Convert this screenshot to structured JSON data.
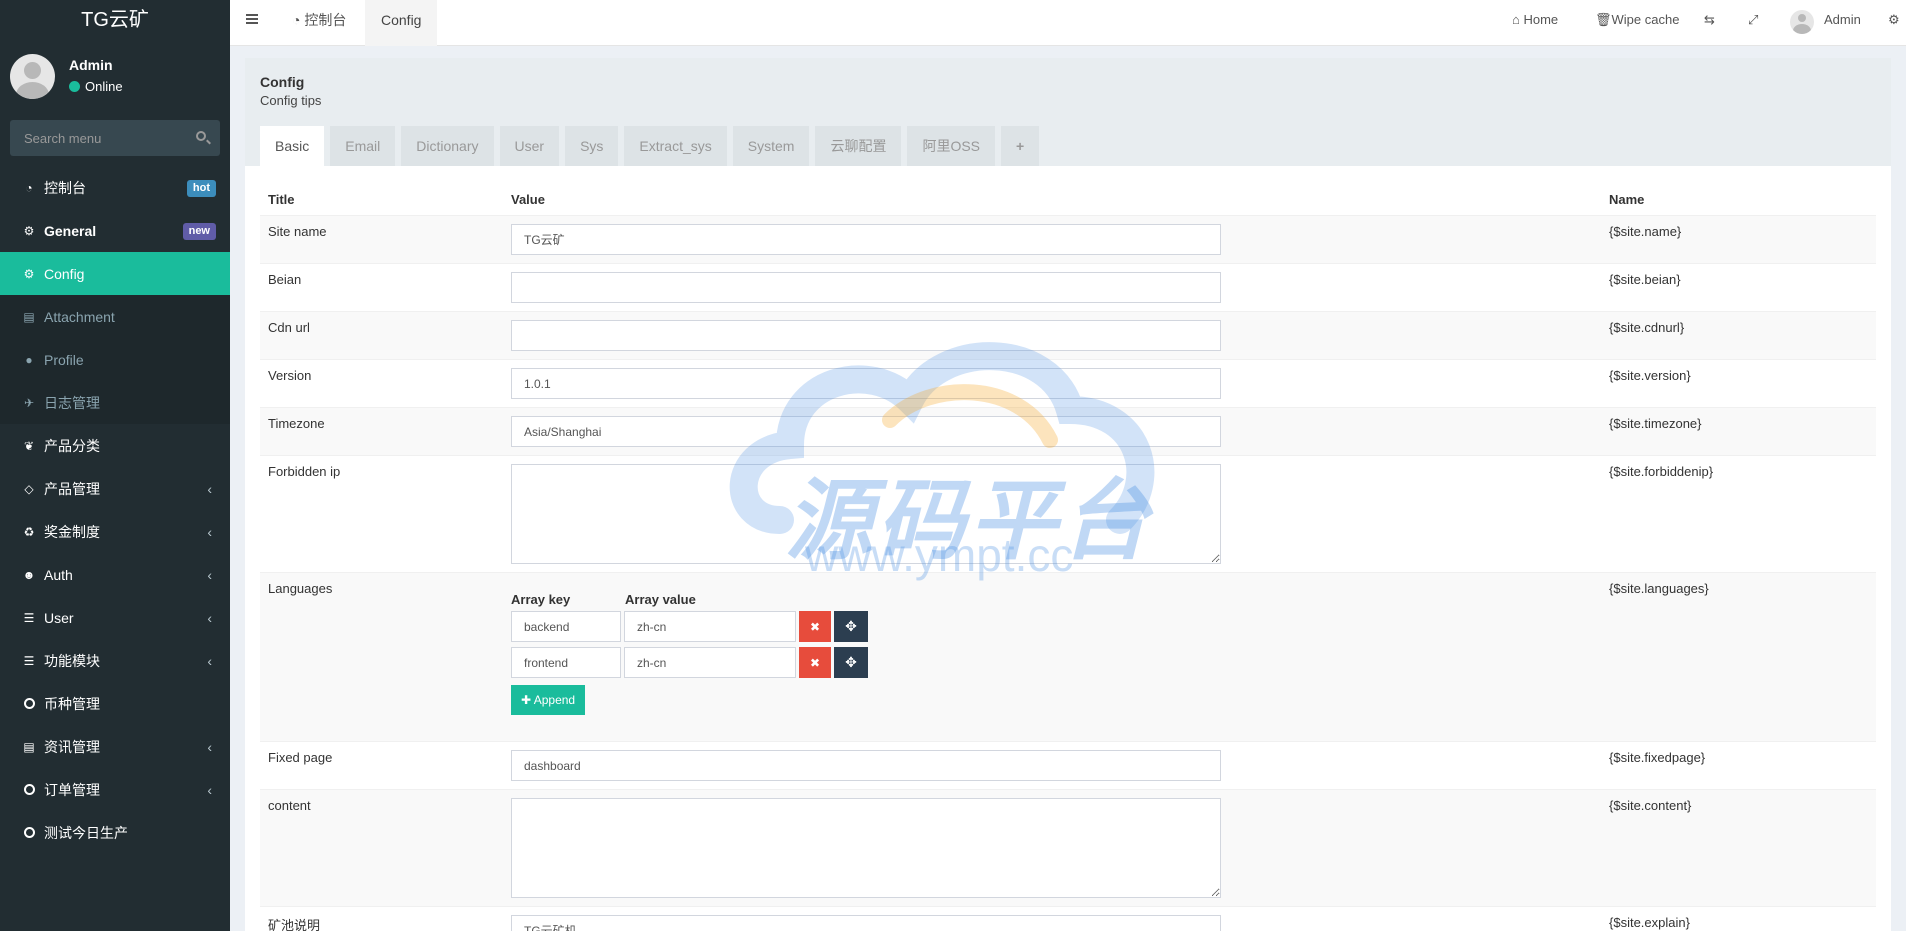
{
  "sidebar": {
    "brand": "TG云矿",
    "user": {
      "name": "Admin",
      "status": "Online"
    },
    "search_placeholder": "Search menu",
    "items": [
      {
        "label": "控制台",
        "icon": "dashboard-icon",
        "badge": "hot"
      },
      {
        "label": "General",
        "icon": "cogs-icon",
        "badge": "new"
      },
      {
        "label": "Config",
        "icon": "cog-icon",
        "active": true
      },
      {
        "label": "Attachment",
        "icon": "file-image-icon"
      },
      {
        "label": "Profile",
        "icon": "user-icon"
      },
      {
        "label": "日志管理",
        "icon": "plane-icon"
      },
      {
        "label": "产品分类",
        "icon": "leaf-icon"
      },
      {
        "label": "产品管理",
        "icon": "diamond-icon"
      },
      {
        "label": "奖金制度",
        "icon": "recycle-icon"
      },
      {
        "label": "Auth",
        "icon": "group-icon"
      },
      {
        "label": "User",
        "icon": "list-icon"
      },
      {
        "label": "功能模块",
        "icon": "list-icon"
      },
      {
        "label": "币种管理",
        "icon": "circle-icon"
      },
      {
        "label": "资讯管理",
        "icon": "list-alt-icon"
      },
      {
        "label": "订单管理",
        "icon": "circle-icon"
      },
      {
        "label": "测试今日生产",
        "icon": "circle-icon"
      }
    ]
  },
  "navbar": {
    "tabs": [
      {
        "label": "控制台"
      },
      {
        "label": "Config"
      }
    ],
    "home": "Home",
    "wipe_cache": "Wipe cache",
    "admin": "Admin"
  },
  "panel": {
    "title": "Config",
    "tips": "Config tips",
    "tabs": [
      "Basic",
      "Email",
      "Dictionary",
      "User",
      "Sys",
      "Extract_sys",
      "System",
      "云聊配置",
      "阿里OSS",
      "+"
    ],
    "columns": {
      "title": "Title",
      "value": "Value",
      "name": "Name"
    },
    "rows": [
      {
        "title": "Site name",
        "value": "TG云矿",
        "name": "{$site.name}"
      },
      {
        "title": "Beian",
        "value": "",
        "name": "{$site.beian}"
      },
      {
        "title": "Cdn url",
        "value": "",
        "name": "{$site.cdnurl}"
      },
      {
        "title": "Version",
        "value": "1.0.1",
        "name": "{$site.version}"
      },
      {
        "title": "Timezone",
        "value": "Asia/Shanghai",
        "name": "{$site.timezone}"
      },
      {
        "title": "Forbidden ip",
        "value": "",
        "name": "{$site.forbiddenip}"
      },
      {
        "title": "Languages",
        "name": "{$site.languages}"
      },
      {
        "title": "Fixed page",
        "value": "dashboard",
        "name": "{$site.fixedpage}"
      },
      {
        "title": "content",
        "value": "",
        "name": "{$site.content}"
      },
      {
        "title": "矿池说明",
        "value": "TG云矿机",
        "name": "{$site.explain}"
      }
    ],
    "languages": {
      "key_header": "Array key",
      "value_header": "Array value",
      "pairs": [
        {
          "key": "backend",
          "value": "zh-cn"
        },
        {
          "key": "frontend",
          "value": "zh-cn"
        }
      ],
      "append_label": "Append"
    }
  },
  "watermark": {
    "text": "源码平台",
    "url": "www.ympt.cc"
  }
}
